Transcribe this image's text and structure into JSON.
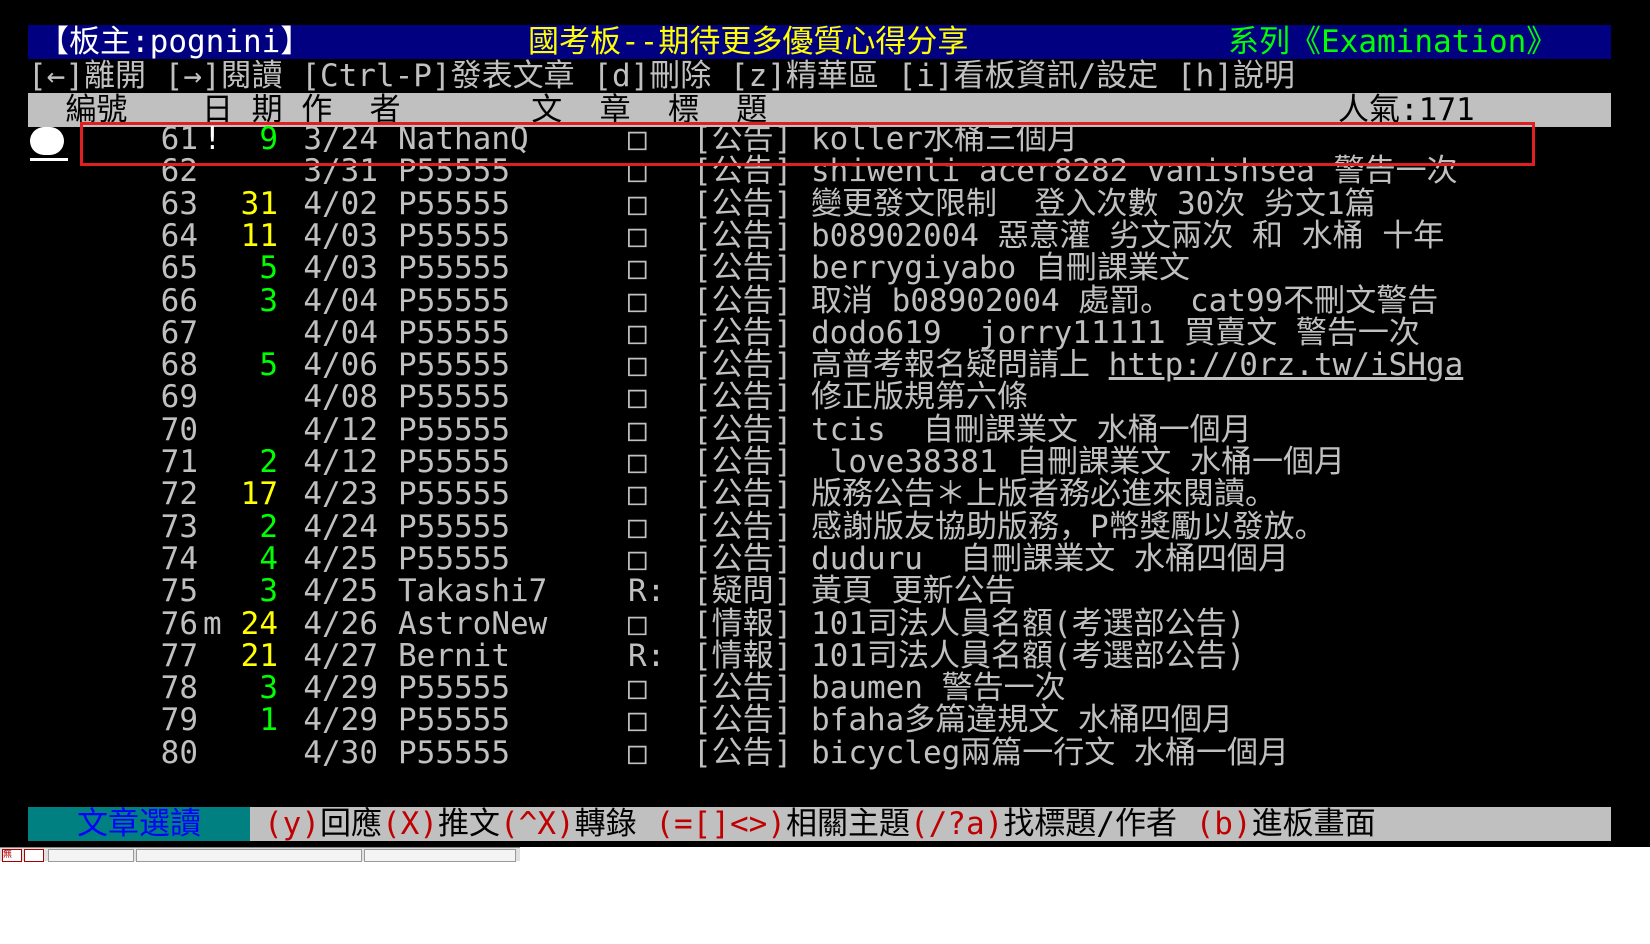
{
  "title_bar": {
    "board_master": "【板主:pognini】",
    "board_title": "國考板--期待更多優質心得分享",
    "board_series": "系列《Examination》"
  },
  "help_bar": "[←]離開 [→]閱讀 [Ctrl-P]發表文章 [d]刪除 [z]精華區 [i]看板資訊/設定 [h]說明",
  "header": {
    "cols": "  編號    日 期 作  者       文  章  標  題",
    "popularity": "人氣:171"
  },
  "rows": [
    {
      "num": "61",
      "mark": "!",
      "rec": "9",
      "rec_color": "green",
      "date": "3/24",
      "author": "NathanQ",
      "state": "□",
      "title": "[公告] koller水桶三個月"
    },
    {
      "num": "62",
      "mark": "",
      "rec": "",
      "rec_color": "",
      "date": "3/31",
      "author": "P55555",
      "state": "□",
      "title": "[公告] shiwenli acer8282 vanishsea 警告一次"
    },
    {
      "num": "63",
      "mark": "",
      "rec": "31",
      "rec_color": "yellow",
      "date": "4/02",
      "author": "P55555",
      "state": "□",
      "title": "[公告] 變更發文限制  登入次數 30次 劣文1篇"
    },
    {
      "num": "64",
      "mark": "",
      "rec": "11",
      "rec_color": "yellow",
      "date": "4/03",
      "author": "P55555",
      "state": "□",
      "title": "[公告] b08902004 惡意灌 劣文兩次 和 水桶 十年"
    },
    {
      "num": "65",
      "mark": "",
      "rec": "5",
      "rec_color": "green",
      "date": "4/03",
      "author": "P55555",
      "state": "□",
      "title": "[公告] berrygiyabo 自刪課業文"
    },
    {
      "num": "66",
      "mark": "",
      "rec": "3",
      "rec_color": "green",
      "date": "4/04",
      "author": "P55555",
      "state": "□",
      "title": "[公告] 取消 b08902004 處罰。 cat99不刪文警告"
    },
    {
      "num": "67",
      "mark": "",
      "rec": "",
      "rec_color": "",
      "date": "4/04",
      "author": "P55555",
      "state": "□",
      "title": "[公告] dodo619  jorry11111 買賣文 警告一次"
    },
    {
      "num": "68",
      "mark": "",
      "rec": "5",
      "rec_color": "green",
      "date": "4/06",
      "author": "P55555",
      "state": "□",
      "title": "[公告] 高普考報名疑問請上 ",
      "link": "http://0rz.tw/iSHga"
    },
    {
      "num": "69",
      "mark": "",
      "rec": "",
      "rec_color": "",
      "date": "4/08",
      "author": "P55555",
      "state": "□",
      "title": "[公告] 修正版規第六條"
    },
    {
      "num": "70",
      "mark": "",
      "rec": "",
      "rec_color": "",
      "date": "4/12",
      "author": "P55555",
      "state": "□",
      "title": "[公告] tcis  自刪課業文 水桶一個月"
    },
    {
      "num": "71",
      "mark": "",
      "rec": "2",
      "rec_color": "green",
      "date": "4/12",
      "author": "P55555",
      "state": "□",
      "title": "[公告]  love38381 自刪課業文 水桶一個月"
    },
    {
      "num": "72",
      "mark": "",
      "rec": "17",
      "rec_color": "yellow",
      "date": "4/23",
      "author": "P55555",
      "state": "□",
      "title": "[公告] 版務公告＊上版者務必進來閱讀。"
    },
    {
      "num": "73",
      "mark": "",
      "rec": "2",
      "rec_color": "green",
      "date": "4/24",
      "author": "P55555",
      "state": "□",
      "title": "[公告] 感謝版友協助版務，P幣獎勵以發放。"
    },
    {
      "num": "74",
      "mark": "",
      "rec": "4",
      "rec_color": "green",
      "date": "4/25",
      "author": "P55555",
      "state": "□",
      "title": "[公告] duduru  自刪課業文 水桶四個月"
    },
    {
      "num": "75",
      "mark": "",
      "rec": "3",
      "rec_color": "green",
      "date": "4/25",
      "author": "Takashi7",
      "state": "R:",
      "title": "[疑問] 黃頁 更新公告"
    },
    {
      "num": "76",
      "mark": "m",
      "rec": "24",
      "rec_color": "yellow",
      "date": "4/26",
      "author": "AstroNew",
      "state": "□",
      "title": "[情報] 101司法人員名額(考選部公告)"
    },
    {
      "num": "77",
      "mark": "",
      "rec": "21",
      "rec_color": "yellow",
      "date": "4/27",
      "author": "Bernit",
      "state": "R:",
      "title": "[情報] 101司法人員名額(考選部公告)"
    },
    {
      "num": "78",
      "mark": "",
      "rec": "3",
      "rec_color": "green",
      "date": "4/29",
      "author": "P55555",
      "state": "□",
      "title": "[公告] baumen 警告一次"
    },
    {
      "num": "79",
      "mark": "",
      "rec": "1",
      "rec_color": "green",
      "date": "4/29",
      "author": "P55555",
      "state": "□",
      "title": "[公告] bfaha多篇違規文 水桶四個月"
    },
    {
      "num": "80",
      "mark": "",
      "rec": "",
      "rec_color": "",
      "date": "4/30",
      "author": "P55555",
      "state": "□",
      "title": "[公告] bicycleg兩篇一行文 水桶一個月"
    }
  ],
  "status_bar": {
    "mode": "文章選讀",
    "hints": [
      {
        "key": "(y)",
        "text": "回應"
      },
      {
        "key": "(X)",
        "text": "推文"
      },
      {
        "key": "(^X)",
        "text": "轉錄 "
      },
      {
        "key": "(=[]<>)",
        "text": "相關主題"
      },
      {
        "key": "(/?a)",
        "text": "找標題/作者 "
      },
      {
        "key": "(b)",
        "text": "進板畫面"
      }
    ]
  },
  "taskbar": {
    "icon_label": "無"
  },
  "colors": {
    "title_bg": "#000080",
    "green": "#00ff00",
    "yellow": "#ffff00",
    "highlight": "#e02020",
    "status_mode_bg": "#008080"
  }
}
